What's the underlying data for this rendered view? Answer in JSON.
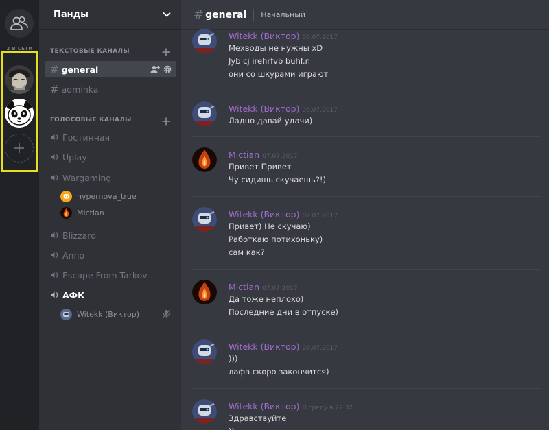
{
  "rail": {
    "online_label": "2 В СЕТИ",
    "servers": [
      {
        "name": "server-avatar-man-icon"
      },
      {
        "name": "server-panda-icon"
      }
    ],
    "highlight_color": "#e6df1e"
  },
  "sidebar": {
    "guild_name": "Панды",
    "text_category": "ТЕКСТОВЫЕ КАНАЛЫ",
    "voice_category": "ГОЛОСОВЫЕ КАНАЛЫ",
    "text_channels": [
      {
        "label": "general"
      },
      {
        "label": "adminka"
      }
    ],
    "voice_channels": [
      {
        "label": "Гостинная"
      },
      {
        "label": "Uplay"
      },
      {
        "label": "Wargaming"
      },
      {
        "label": "Blizzard"
      },
      {
        "label": "Anno"
      },
      {
        "label": "Escape From Tarkov"
      },
      {
        "label": "АФК"
      }
    ],
    "voice_users": [
      {
        "label": "hypernova_true"
      },
      {
        "label": "Mictian"
      },
      {
        "label": "Witekk (Виктор)"
      }
    ]
  },
  "chat": {
    "hash": "#",
    "channel": "general",
    "topic": "Начальный",
    "author_color": "#a16cce",
    "messages": [
      {
        "author": "Witekk (Виктор)",
        "time": "06.07.2017",
        "lines": [
          "Мехводы не нужны xD",
          "Jyb cj irehrfvb buhf.n",
          "они со шкурами играют"
        ]
      },
      {
        "author": "Witekk (Виктор)",
        "time": "06.07.2017",
        "lines": [
          "Ладно давай удачи)"
        ]
      },
      {
        "author": "Mictian",
        "time": "07.07.2017",
        "lines": [
          "Привет Привет",
          "Чу сидишь скучаешь?!)"
        ]
      },
      {
        "author": "Witekk (Виктор)",
        "time": "07.07.2017",
        "lines": [
          "Привет) Не скучаю)",
          "Работкаю потихоньку)",
          "сам как?"
        ]
      },
      {
        "author": "Mictian",
        "time": "07.07.2017",
        "lines": [
          "Да тоже неплохо)",
          "Последние дни в отпуске)"
        ]
      },
      {
        "author": "Witekk (Виктор)",
        "time": "07.07.2017",
        "lines": [
          ")))",
          "лафа скоро закончится)"
        ]
      },
      {
        "author": "Witekk (Виктор)",
        "time": "В среду в 22:32",
        "lines": [
          "Здравствуйте",
          "))"
        ]
      }
    ]
  }
}
